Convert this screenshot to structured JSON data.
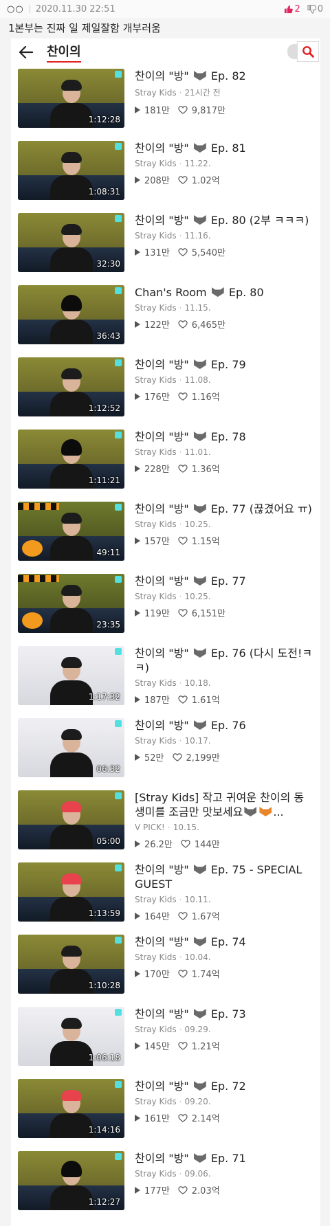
{
  "post": {
    "dots": "○○",
    "date": "2020.11.30 22:51",
    "upvotes": "2",
    "downvotes": "0",
    "caption": "1본부는 진짜 일 제일잘함 개부러움"
  },
  "search": {
    "query": "찬이의"
  },
  "videos": [
    {
      "title_pre": "찬이의 \"방\"",
      "title_post": "Ep. 82",
      "channel": "Stray Kids",
      "date": "21시간 전",
      "plays": "181만",
      "likes": "9,817만",
      "duration": "1:12:28",
      "thumb": "default"
    },
    {
      "title_pre": "찬이의 \"방\"",
      "title_post": "Ep. 81",
      "channel": "Stray Kids",
      "date": "11.22.",
      "plays": "208만",
      "likes": "1.02억",
      "duration": "1:08:31",
      "thumb": "default"
    },
    {
      "title_pre": "찬이의 \"방\"",
      "title_post": "Ep. 80 (2부 ㅋㅋㅋ)",
      "channel": "Stray Kids",
      "date": "11.16.",
      "plays": "131만",
      "likes": "5,540만",
      "duration": "32:30",
      "thumb": "default"
    },
    {
      "title_pre": "Chan's Room",
      "title_post": "Ep. 80",
      "channel": "Stray Kids",
      "date": "11.15.",
      "plays": "122만",
      "likes": "6,465만",
      "duration": "36:43",
      "thumb": "cap"
    },
    {
      "title_pre": "찬이의 \"방\"",
      "title_post": "Ep. 79",
      "channel": "Stray Kids",
      "date": "11.08.",
      "plays": "176만",
      "likes": "1.16억",
      "duration": "1:12:52",
      "thumb": "default"
    },
    {
      "title_pre": "찬이의 \"방\"",
      "title_post": "Ep. 78",
      "channel": "Stray Kids",
      "date": "11.01.",
      "plays": "228만",
      "likes": "1.36억",
      "duration": "1:11:21",
      "thumb": "cap"
    },
    {
      "title_pre": "찬이의 \"방\"",
      "title_post": "Ep. 77 (끊겼어요 ㅠ)",
      "channel": "Stray Kids",
      "date": "10.25.",
      "plays": "157만",
      "likes": "1.15억",
      "duration": "49:11",
      "thumb": "halloween"
    },
    {
      "title_pre": "찬이의 \"방\"",
      "title_post": "Ep. 77",
      "channel": "Stray Kids",
      "date": "10.25.",
      "plays": "119만",
      "likes": "6,151만",
      "duration": "23:35",
      "thumb": "halloween"
    },
    {
      "title_pre": "찬이의 \"방\"",
      "title_post": "Ep. 76 (다시 도전!ㅋㅋ)",
      "channel": "Stray Kids",
      "date": "10.18.",
      "plays": "187만",
      "likes": "1.61억",
      "duration": "1:17:32",
      "thumb": "white"
    },
    {
      "title_pre": "찬이의 \"방\"",
      "title_post": "Ep. 76",
      "channel": "Stray Kids",
      "date": "10.17.",
      "plays": "52만",
      "likes": "2,199만",
      "duration": "06:32",
      "thumb": "white"
    },
    {
      "title_pre": "[Stray Kids] 작고 귀여운 찬이의 동생미를 조금만 맛보세요",
      "title_post": "...",
      "channel": "V PICK!",
      "date": "10.15.",
      "plays": "26.2만",
      "likes": "144만",
      "duration": "05:00",
      "thumb": "red-hair"
    },
    {
      "title_pre": "찬이의 \"방\"",
      "title_post": "Ep. 75 - SPECIAL GUEST",
      "channel": "Stray Kids",
      "date": "10.11.",
      "plays": "164만",
      "likes": "1.67억",
      "duration": "1:13:59",
      "thumb": "red-hair"
    },
    {
      "title_pre": "찬이의 \"방\"",
      "title_post": "Ep. 74",
      "channel": "Stray Kids",
      "date": "10.04.",
      "plays": "170만",
      "likes": "1.74억",
      "duration": "1:10:28",
      "thumb": "default"
    },
    {
      "title_pre": "찬이의 \"방\"",
      "title_post": "Ep. 73",
      "channel": "Stray Kids",
      "date": "09.29.",
      "plays": "145만",
      "likes": "1.21억",
      "duration": "1:06:18",
      "thumb": "white"
    },
    {
      "title_pre": "찬이의 \"방\"",
      "title_post": "Ep. 72",
      "channel": "Stray Kids",
      "date": "09.20.",
      "plays": "161만",
      "likes": "2.14억",
      "duration": "1:14:16",
      "thumb": "red-hair"
    },
    {
      "title_pre": "찬이의 \"방\"",
      "title_post": "Ep. 71",
      "channel": "Stray Kids",
      "date": "09.06.",
      "plays": "177만",
      "likes": "2.03억",
      "duration": "1:12:27",
      "thumb": "cap"
    }
  ]
}
